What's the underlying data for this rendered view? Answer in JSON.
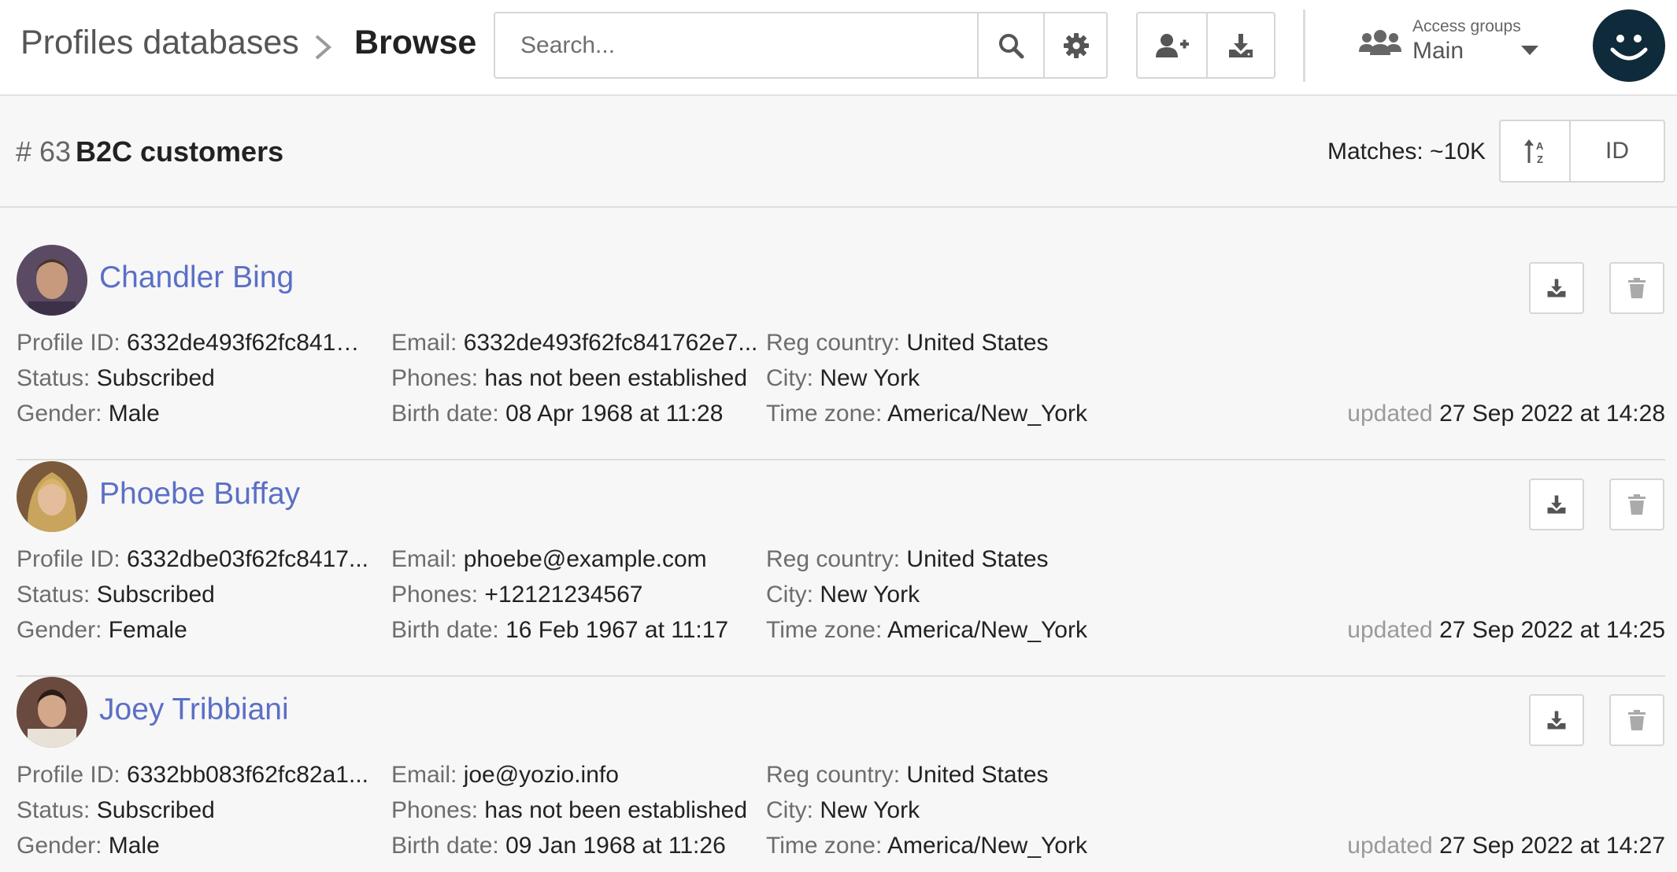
{
  "breadcrumb": {
    "root": "Profiles databases",
    "current": "Browse"
  },
  "search": {
    "placeholder": "Search...",
    "value": ""
  },
  "header_buttons": {
    "search_icon": "search-icon",
    "settings_icon": "gear-icon",
    "add_user_icon": "user-plus-icon",
    "export_icon": "download-icon"
  },
  "access_groups": {
    "label": "Access groups",
    "value": "Main"
  },
  "database": {
    "hash": "# 63",
    "name": "B2C customers"
  },
  "matches": "Matches: ~10K",
  "sort": {
    "field": "ID"
  },
  "labels": {
    "profile_id": "Profile ID: ",
    "status": "Status: ",
    "gender": "Gender: ",
    "email": "Email: ",
    "phones": "Phones: ",
    "birth_date": "Birth date: ",
    "reg_country": "Reg country: ",
    "city": "City: ",
    "time_zone": "Time zone: ",
    "updated": "updated "
  },
  "profiles": [
    {
      "name": "Chandler Bing",
      "profile_id": "6332de493f62fc84176...",
      "status": "Subscribed",
      "gender": "Male",
      "email": "6332de493f62fc841762e7...",
      "phones": "has not been established",
      "birth_date": "08 Apr 1968 at 11:28",
      "reg_country": "United States",
      "city": "New York",
      "time_zone": "America/New_York",
      "updated": "27 Sep 2022 at 14:28"
    },
    {
      "name": "Phoebe Buffay",
      "profile_id": "6332dbe03f62fc8417...",
      "status": "Subscribed",
      "gender": "Female",
      "email": "phoebe@example.com",
      "phones": "+12121234567",
      "birth_date": "16 Feb 1967 at 11:17",
      "reg_country": "United States",
      "city": "New York",
      "time_zone": "America/New_York",
      "updated": "27 Sep 2022 at 14:25"
    },
    {
      "name": "Joey Tribbiani",
      "profile_id": "6332bb083f62fc82a1...",
      "status": "Subscribed",
      "gender": "Male",
      "email": "joe@yozio.info",
      "phones": "has not been established",
      "birth_date": "09 Jan 1968 at 11:26",
      "reg_country": "United States",
      "city": "New York",
      "time_zone": "America/New_York",
      "updated": "27 Sep 2022 at 14:27"
    }
  ]
}
